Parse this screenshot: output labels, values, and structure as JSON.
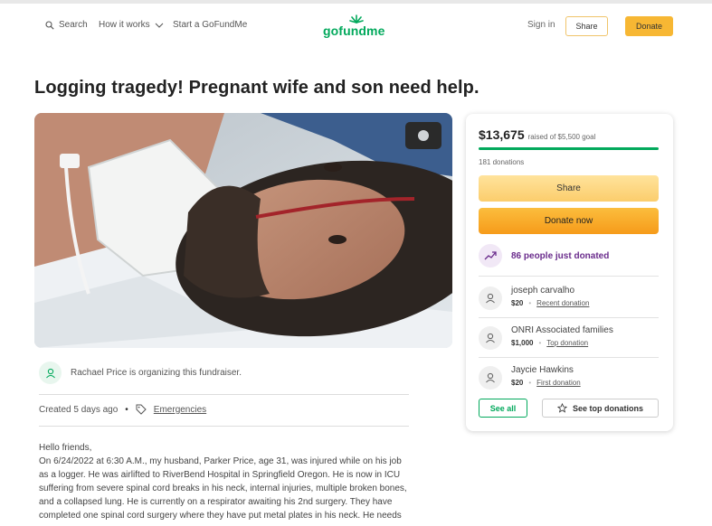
{
  "header": {
    "search_label": "Search",
    "how_label": "How it works",
    "start_label": "Start a GoFundMe",
    "logo_text": "gofundme",
    "signin_label": "Sign in",
    "share_label": "Share",
    "donate_label": "Donate"
  },
  "campaign": {
    "title": "Logging tragedy! Pregnant wife and son need help.",
    "organizer_text": "Rachael Price is organizing this fundraiser.",
    "created": "Created 5 days ago",
    "category": "Emergencies",
    "story": [
      "Hello friends,",
      "On 6/24/2022 at 6:30 A.M., my husband, Parker Price, age 31, was injured while on his job",
      "as a logger. He was airlifted to RiverBend Hospital in Springfield Oregon. He is now in ICU",
      "suffering from severe spinal cord breaks in his neck, internal injuries, multiple broken bones,",
      "and a collapsed lung. He is currently on a respirator awaiting his 2nd surgery. They have",
      "completed one spinal cord surgery where they have put metal plates in his neck. He needs"
    ]
  },
  "donation_card": {
    "raised": "$13,675",
    "goal_text": "raised of $5,500 goal",
    "progress": 1.0,
    "donation_count": "181 donations",
    "share_label": "Share",
    "donate_label": "Donate now",
    "trend_text": "86 people just donated",
    "donors": [
      {
        "name": "joseph carvalho",
        "amount": "$20",
        "tag": "Recent donation"
      },
      {
        "name": "ONRI Associated families",
        "amount": "$1,000",
        "tag": "Top donation"
      },
      {
        "name": "Jaycie Hawkins",
        "amount": "$20",
        "tag": "First donation"
      }
    ],
    "see_all_label": "See all",
    "see_top_label": "See top donations"
  },
  "colors": {
    "brand_green": "#02a95c",
    "accent_orange": "#f7b733",
    "trend_purple": "#6a2c8c"
  }
}
